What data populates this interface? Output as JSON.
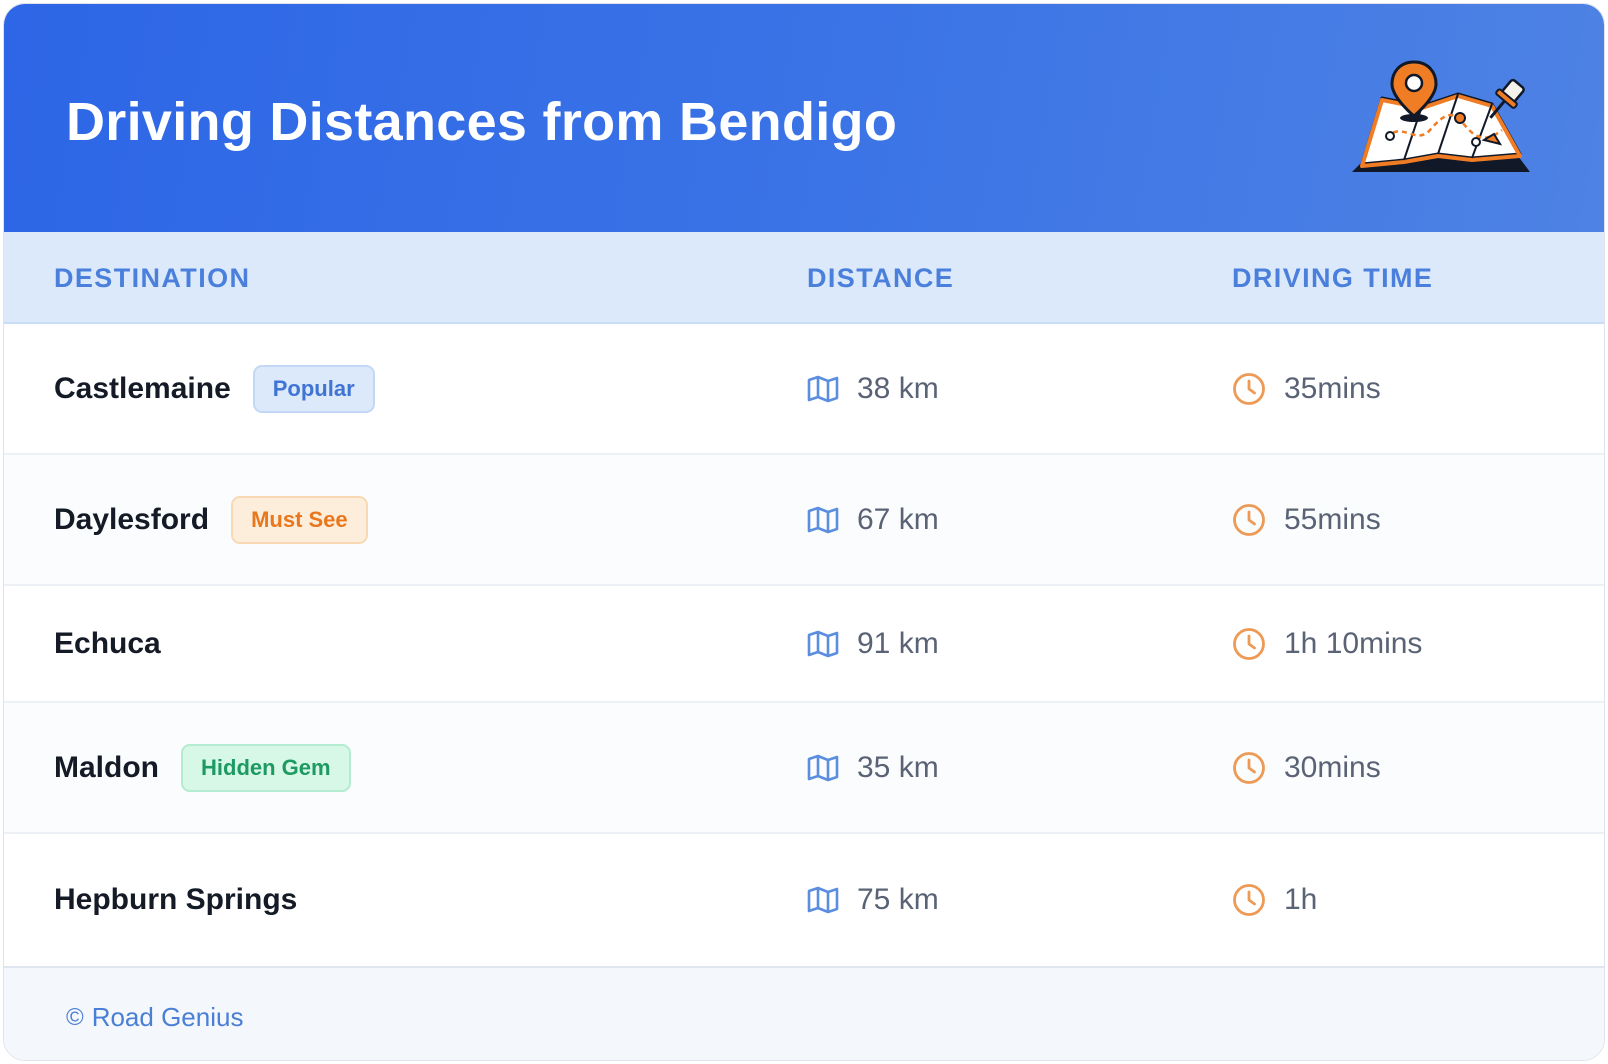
{
  "header": {
    "title": "Driving Distances from Bendigo",
    "illustration": "map-with-pins-illustration"
  },
  "table": {
    "columns": [
      "DESTINATION",
      "DISTANCE",
      "DRIVING TIME"
    ],
    "rows": [
      {
        "destination": "Castlemaine",
        "badge": "Popular",
        "badge_style": "blue",
        "distance": "38 km",
        "time": "35mins"
      },
      {
        "destination": "Daylesford",
        "badge": "Must See",
        "badge_style": "orange",
        "distance": "67 km",
        "time": "55mins"
      },
      {
        "destination": "Echuca",
        "badge": null,
        "badge_style": null,
        "distance": "91 km",
        "time": "1h 10mins"
      },
      {
        "destination": "Maldon",
        "badge": "Hidden Gem",
        "badge_style": "green",
        "distance": "35 km",
        "time": "30mins"
      },
      {
        "destination": "Hepburn Springs",
        "badge": null,
        "badge_style": null,
        "distance": "75 km",
        "time": "1h"
      }
    ],
    "icons": {
      "distance": "map-icon",
      "time": "clock-icon"
    }
  },
  "footer": {
    "copyright_symbol": "©",
    "credit": "Road Genius"
  },
  "colors": {
    "header_gradient_start": "#2d66e6",
    "header_gradient_end": "#4e82e4",
    "column_header_text": "#4a80dc",
    "map_icon": "#5b8de0",
    "clock_icon": "#ee9a57",
    "badge_popular": "#3f74d4",
    "badge_must_see": "#e8771d",
    "badge_hidden_gem": "#1d9a62"
  }
}
